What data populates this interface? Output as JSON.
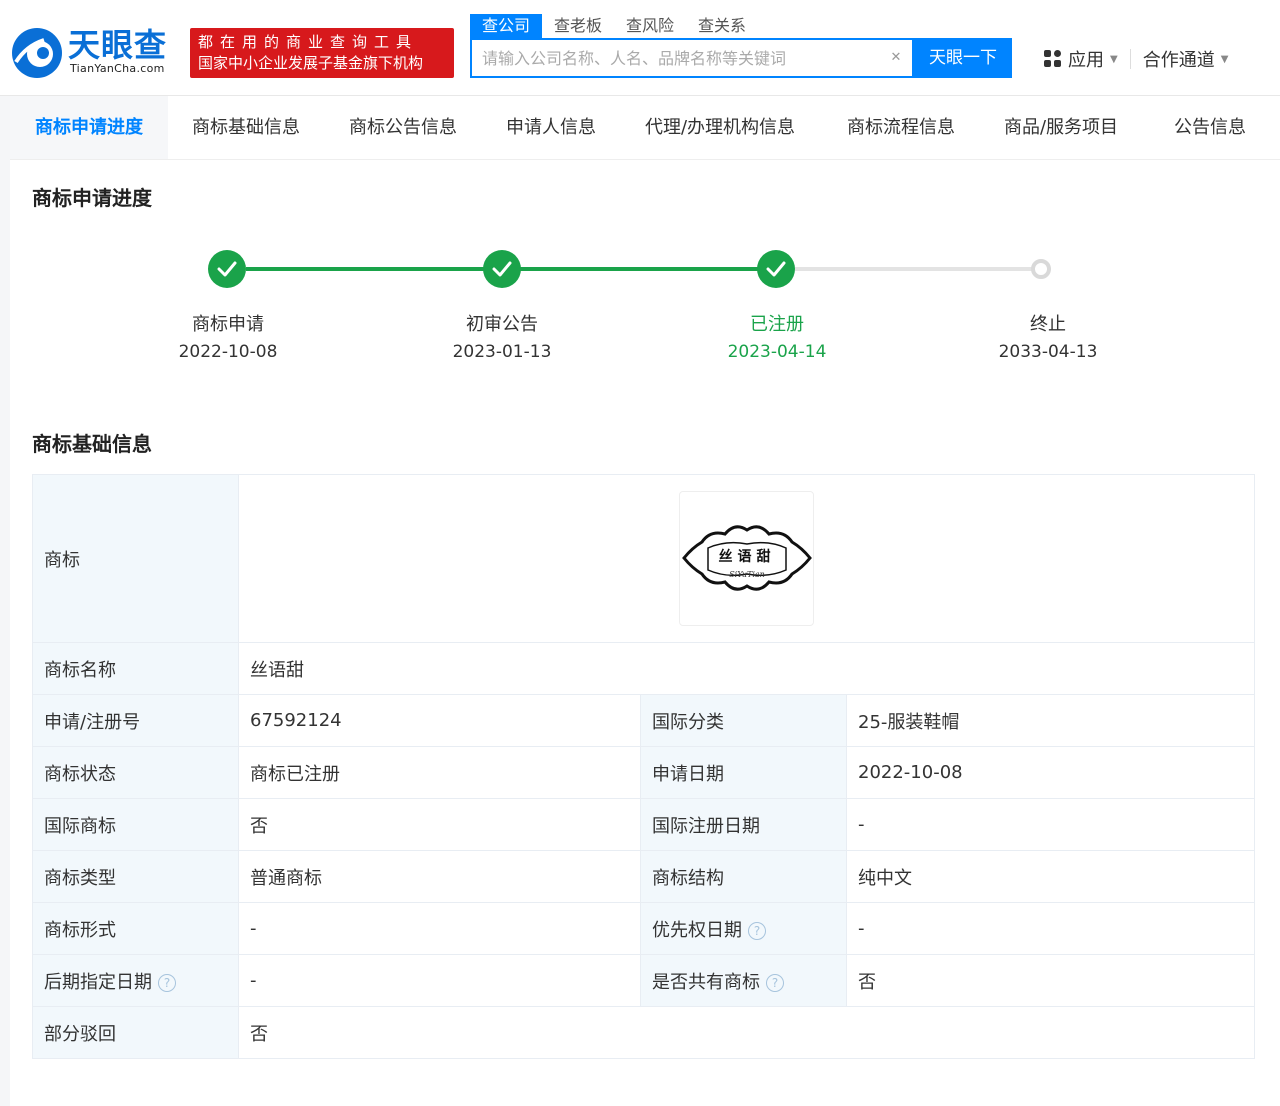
{
  "brand": {
    "name": "天眼查",
    "domain": "TianYanCha.com",
    "banner_line1": "都在用的商业查询工具",
    "banner_line2": "国家中小企业发展子基金旗下机构"
  },
  "search": {
    "tabs": [
      "查公司",
      "查老板",
      "查风险",
      "查关系"
    ],
    "active_tab": "查公司",
    "placeholder": "请输入公司名称、人名、品牌名称等关键词",
    "value": "",
    "button": "天眼一下",
    "clear_icon": "close-icon"
  },
  "header_right": {
    "apps": "应用",
    "partner": "合作通道"
  },
  "tabs": [
    {
      "label": "商标申请进度",
      "active": true
    },
    {
      "label": "商标基础信息",
      "active": false
    },
    {
      "label": "商标公告信息",
      "active": false
    },
    {
      "label": "申请人信息",
      "active": false
    },
    {
      "label": "代理/办理机构信息",
      "active": false
    },
    {
      "label": "商标流程信息",
      "active": false
    },
    {
      "label": "商品/服务项目",
      "active": false
    },
    {
      "label": "公告信息",
      "active": false
    }
  ],
  "progress": {
    "title": "商标申请进度",
    "steps": [
      {
        "label": "商标申请",
        "date": "2022-10-08",
        "status": "done"
      },
      {
        "label": "初审公告",
        "date": "2023-01-13",
        "status": "done"
      },
      {
        "label": "已注册",
        "date": "2023-04-14",
        "status": "current"
      },
      {
        "label": "终止",
        "date": "2033-04-13",
        "status": "pending"
      }
    ],
    "colors": {
      "done": "#1aa34a",
      "pending": "#d9d9d9",
      "accent": "#0084ff"
    }
  },
  "basic": {
    "title": "商标基础信息",
    "logo_label": "商标",
    "logo_text": "丝语甜",
    "logo_subtext": "SiYuTian",
    "rows": [
      {
        "k1": "商标名称",
        "v1": "丝语甜"
      },
      {
        "k1": "申请/注册号",
        "v1": "67592124",
        "k2": "国际分类",
        "v2": "25-服装鞋帽"
      },
      {
        "k1": "商标状态",
        "v1": "商标已注册",
        "k2": "申请日期",
        "v2": "2022-10-08"
      },
      {
        "k1": "国际商标",
        "v1": "否",
        "k2": "国际注册日期",
        "v2": "-"
      },
      {
        "k1": "商标类型",
        "v1": "普通商标",
        "k2": "商标结构",
        "v2": "纯中文"
      },
      {
        "k1": "商标形式",
        "v1": "-",
        "k2": "优先权日期",
        "v2": "-",
        "k2_help": true
      },
      {
        "k1": "后期指定日期",
        "v1": "-",
        "k2": "是否共有商标",
        "v2": "否",
        "k1_help": true,
        "k2_help": true
      },
      {
        "k1": "部分驳回",
        "v1": "否"
      }
    ],
    "help_icon": "?"
  }
}
